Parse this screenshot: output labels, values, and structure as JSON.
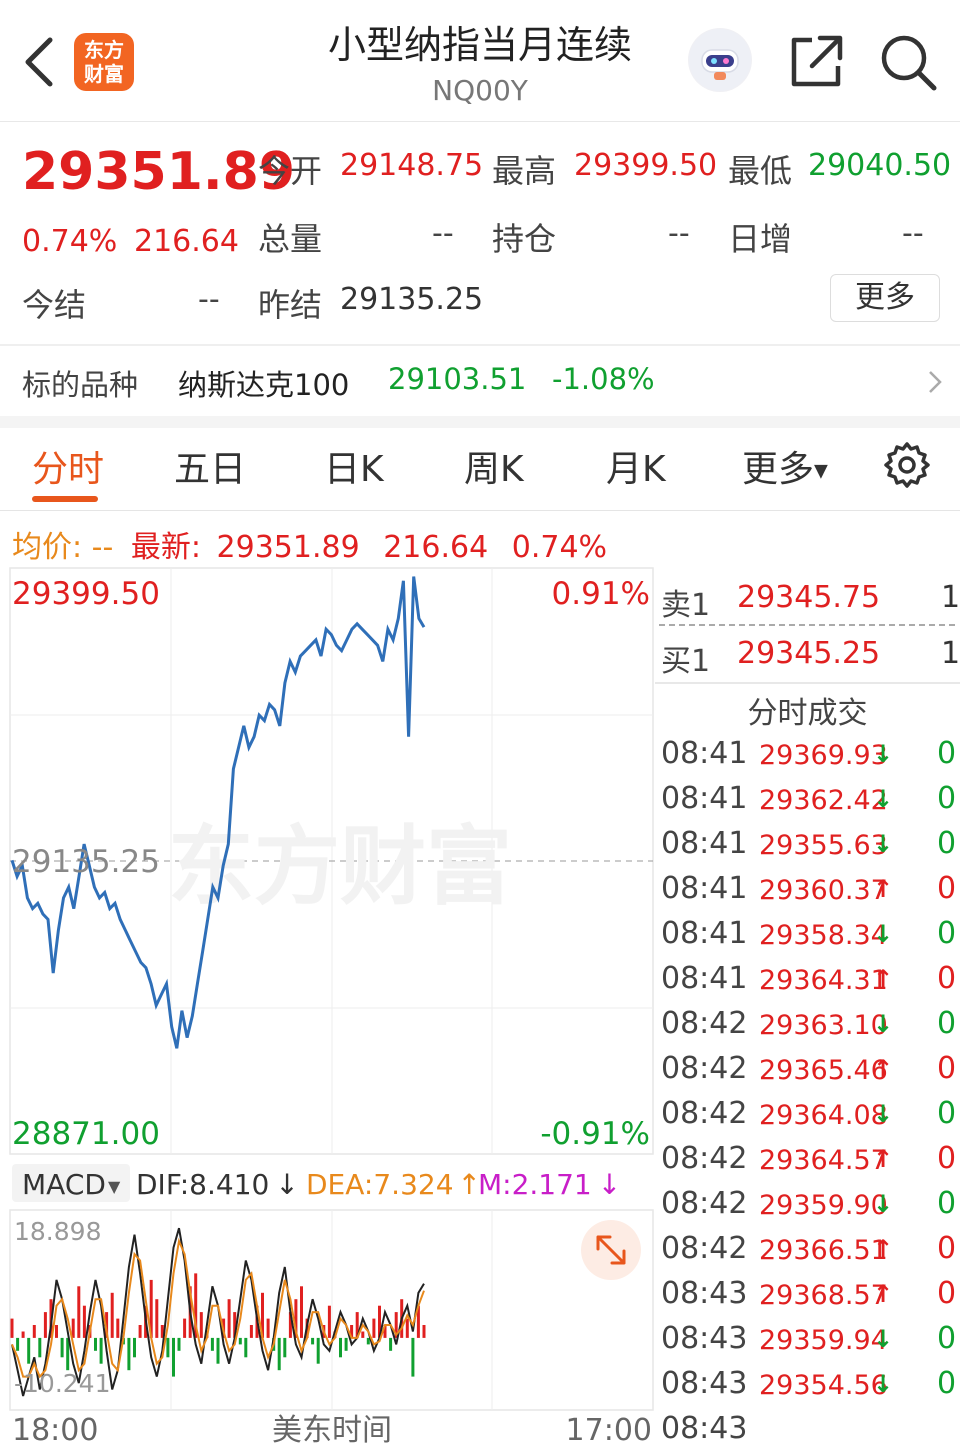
{
  "header": {
    "back_icon": "chevron-left-icon",
    "logo_line1": "东方",
    "logo_line2": "财富",
    "title": "小型纳指当月连续",
    "code": "NQ00Y"
  },
  "quote": {
    "price": "29351.89",
    "change_pct": "0.74%",
    "change_val": "216.64",
    "open_label": "今开",
    "open": "29148.75",
    "high_label": "最高",
    "high": "29399.50",
    "low_label": "最低",
    "low": "29040.50",
    "volume_label": "总量",
    "volume": "--",
    "oi_label": "持仓",
    "oi": "--",
    "daily_inc_label": "日增",
    "daily_inc": "--",
    "settle_label": "今结",
    "settle": "--",
    "prev_settle_label": "昨结",
    "prev_settle": "29135.25",
    "more_label": "更多"
  },
  "underlying": {
    "label": "标的品种",
    "name": "纳斯达克100",
    "value": "29103.51",
    "change": "-1.08%"
  },
  "tabs": [
    "分时",
    "五日",
    "日K",
    "周K",
    "月K",
    "更多"
  ],
  "active_tab": 0,
  "info_line": {
    "avg_label": "均价:",
    "avg_value": "--",
    "latest_label": "最新:",
    "latest_value": "29351.89",
    "change_val": "216.64",
    "change_pct": "0.74%"
  },
  "chart_labels": {
    "y_top": "29399.50",
    "y_mid": "29135.25",
    "y_bottom": "28871.00",
    "pct_top": "0.91%",
    "pct_bottom": "-0.91%",
    "watermark": "东方财富",
    "x_start": "18:00",
    "x_mid": "美东时间",
    "x_end": "17:00"
  },
  "macd": {
    "selector": "MACD",
    "dif": "DIF:8.410",
    "dif_dir": "↓",
    "dea": "DEA:7.324",
    "dea_dir": "↑",
    "m": "M:2.171",
    "m_dir": "↓",
    "y_top": "18.898",
    "y_bottom": "-10.241"
  },
  "orderbook": {
    "sell_label": "卖1",
    "sell_price": "29345.75",
    "sell_vol": "1",
    "buy_label": "买1",
    "buy_price": "29345.25",
    "buy_vol": "1"
  },
  "trades_title": "分时成交",
  "trades": [
    {
      "time": "08:41",
      "price": "29369.93",
      "dir": "↓",
      "vol": "0"
    },
    {
      "time": "08:41",
      "price": "29362.42",
      "dir": "↓",
      "vol": "0"
    },
    {
      "time": "08:41",
      "price": "29355.63",
      "dir": "↓",
      "vol": "0"
    },
    {
      "time": "08:41",
      "price": "29360.37",
      "dir": "↑",
      "vol": "0"
    },
    {
      "time": "08:41",
      "price": "29358.34",
      "dir": "↓",
      "vol": "0"
    },
    {
      "time": "08:41",
      "price": "29364.31",
      "dir": "↑",
      "vol": "0"
    },
    {
      "time": "08:42",
      "price": "29363.10",
      "dir": "↓",
      "vol": "0"
    },
    {
      "time": "08:42",
      "price": "29365.46",
      "dir": "↑",
      "vol": "0"
    },
    {
      "time": "08:42",
      "price": "29364.08",
      "dir": "↓",
      "vol": "0"
    },
    {
      "time": "08:42",
      "price": "29364.57",
      "dir": "↑",
      "vol": "0"
    },
    {
      "time": "08:42",
      "price": "29359.90",
      "dir": "↓",
      "vol": "0"
    },
    {
      "time": "08:42",
      "price": "29366.51",
      "dir": "↑",
      "vol": "0"
    },
    {
      "time": "08:43",
      "price": "29368.57",
      "dir": "↑",
      "vol": "0"
    },
    {
      "time": "08:43",
      "price": "29359.94",
      "dir": "↓",
      "vol": "0"
    },
    {
      "time": "08:43",
      "price": "29354.56",
      "dir": "↓",
      "vol": "0"
    },
    {
      "time": "08:43",
      "price": "",
      "dir": "",
      "vol": ""
    }
  ],
  "colors": {
    "up": "#e02020",
    "down": "#10a030",
    "line": "#2f6fb8",
    "dea": "#e8891c",
    "m": "#c81ec8",
    "accent": "#e8561c"
  },
  "chart_data": [
    {
      "type": "line",
      "name": "intraday",
      "y_range": [
        28871.0,
        29399.5
      ],
      "reference": 29135.25,
      "values": [
        29135,
        29120,
        29130,
        29100,
        29090,
        29095,
        29085,
        29080,
        29030,
        29070,
        29100,
        29110,
        29090,
        29120,
        29150,
        29130,
        29110,
        29100,
        29105,
        29090,
        29095,
        29080,
        29070,
        29060,
        29050,
        29040,
        29035,
        29020,
        29000,
        29010,
        29020,
        28980,
        28960,
        28995,
        28970,
        28990,
        29020,
        29050,
        29080,
        29110,
        29100,
        29130,
        29150,
        29220,
        29240,
        29260,
        29240,
        29250,
        29270,
        29265,
        29280,
        29275,
        29260,
        29300,
        29320,
        29310,
        29325,
        29330,
        29335,
        29340,
        29325,
        29350,
        29345,
        29335,
        29330,
        29340,
        29350,
        29355,
        29350,
        29345,
        29340,
        29335,
        29320,
        29350,
        29340,
        29360,
        29395,
        29250,
        29399,
        29360,
        29352
      ]
    },
    {
      "type": "bar",
      "name": "MACD",
      "y_range": [
        -10.241,
        18.898
      ],
      "values": [
        3,
        -2,
        1,
        -4,
        2,
        -3,
        4,
        6,
        2,
        -3,
        -5,
        3,
        8,
        5,
        2,
        -2,
        -4,
        4,
        7,
        3,
        -1,
        -5,
        -3,
        2,
        5,
        9,
        6,
        2,
        -3,
        -6,
        -2,
        3,
        8,
        10,
        4,
        1,
        -2,
        -4,
        3,
        6,
        4,
        -1,
        -3,
        2,
        5,
        7,
        3,
        -2,
        -5,
        -3,
        4,
        6,
        8,
        3,
        -1,
        -4,
        2,
        5,
        1,
        -3,
        -2,
        2,
        4,
        1,
        -1,
        3,
        5,
        2,
        -2,
        4,
        6,
        3,
        -6,
        5,
        2
      ]
    },
    {
      "type": "line",
      "name": "DIF",
      "y_range": [
        -10.241,
        18.898
      ],
      "values": [
        -1,
        -5,
        -9,
        -6,
        -3,
        -8,
        -4,
        2,
        9,
        6,
        1,
        -4,
        -7,
        -2,
        4,
        9,
        5,
        -2,
        -8,
        -5,
        3,
        11,
        16,
        10,
        3,
        -3,
        -6,
        -2,
        6,
        14,
        17,
        12,
        4,
        -1,
        -4,
        2,
        8,
        5,
        -1,
        -4,
        0,
        6,
        12,
        9,
        3,
        -2,
        -5,
        0,
        7,
        11,
        4,
        -1,
        -3,
        2,
        6,
        3,
        -1,
        -2,
        1,
        4,
        2,
        -1,
        0,
        3,
        1,
        -2,
        0,
        4,
        2,
        -1,
        3,
        5,
        1,
        7,
        8.41
      ]
    },
    {
      "type": "line",
      "name": "DEA",
      "y_range": [
        -10.241,
        18.898
      ],
      "values": [
        -1,
        -3,
        -6,
        -6,
        -4,
        -6,
        -5,
        -1,
        5,
        6,
        3,
        -1,
        -5,
        -4,
        1,
        6,
        6,
        1,
        -4,
        -5,
        0,
        7,
        13,
        12,
        6,
        0,
        -4,
        -3,
        2,
        10,
        15,
        13,
        7,
        2,
        -2,
        0,
        5,
        5,
        1,
        -2,
        -1,
        3,
        9,
        10,
        5,
        0,
        -3,
        -1,
        4,
        9,
        6,
        1,
        -2,
        0,
        4,
        4,
        1,
        -1,
        0,
        3,
        2,
        0,
        0,
        2,
        1,
        -1,
        -0.5,
        2,
        2,
        0.5,
        1.5,
        3.5,
        2,
        5,
        7.324
      ]
    }
  ]
}
